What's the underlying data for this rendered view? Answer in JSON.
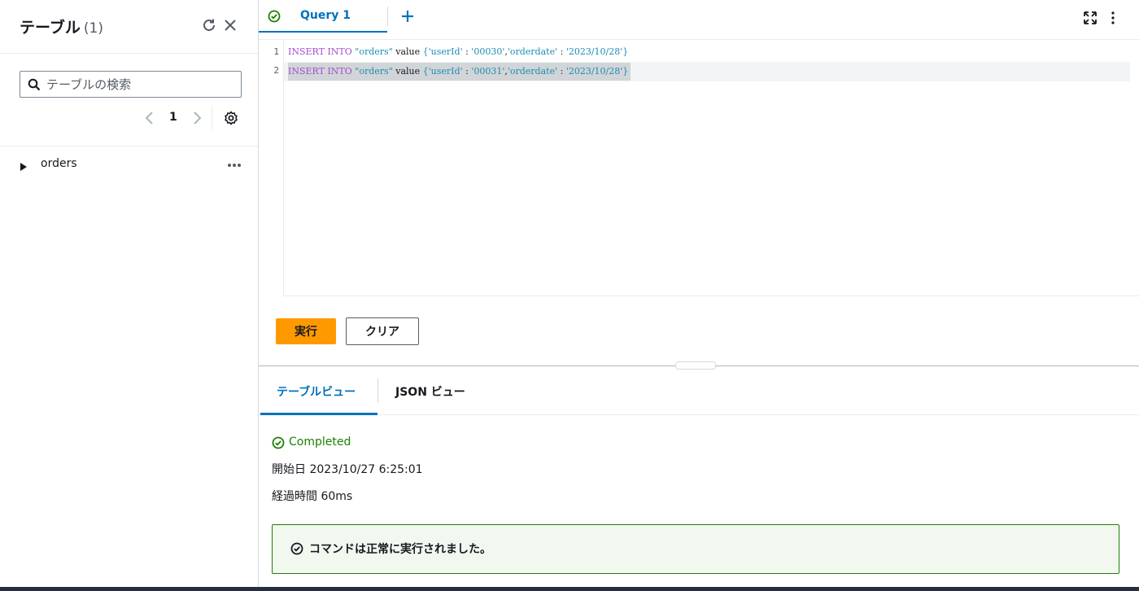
{
  "left_panel": {
    "title": "テーブル",
    "count": "(1)",
    "search": {
      "placeholder": "テーブルの検索",
      "value": ""
    },
    "pagination": {
      "current_page": "1"
    },
    "tables": [
      {
        "name": "orders"
      }
    ]
  },
  "query_tabs": {
    "tabs": [
      {
        "label": "Query 1",
        "status": "success"
      }
    ]
  },
  "editor": {
    "lines": [
      {
        "number": "1",
        "kw1": "INSERT INTO",
        "table": "\"orders\"",
        "kw2": "value",
        "brace_open": "{",
        "key1": "'userId'",
        "sep1": " : ",
        "val1": "'00030'",
        "comma": ",",
        "key2": "'orderdate'",
        "sep2": " : ",
        "val2": "'2023/10/28'",
        "brace_close": "}"
      },
      {
        "number": "2",
        "kw1": "INSERT INTO",
        "table": "\"orders\"",
        "kw2": "value",
        "brace_open": "{",
        "key1": "'userId'",
        "sep1": " : ",
        "val1": "'00031'",
        "comma": ",",
        "key2": "'orderdate'",
        "sep2": " : ",
        "val2": "'2023/10/28'",
        "brace_close": "}"
      }
    ]
  },
  "actions": {
    "run_label": "実行",
    "clear_label": "クリア"
  },
  "results": {
    "tabs": [
      {
        "label": "テーブルビュー"
      },
      {
        "label": "JSON ビュー"
      }
    ],
    "status": "Completed",
    "start_time": "開始日 2023/10/27 6:25:01",
    "elapsed": "経過時間 60ms",
    "message": "コマンドは正常に実行されました。"
  },
  "colors": {
    "accent": "#0073bb",
    "primary_button": "#ff9900",
    "success": "#1d8102"
  }
}
